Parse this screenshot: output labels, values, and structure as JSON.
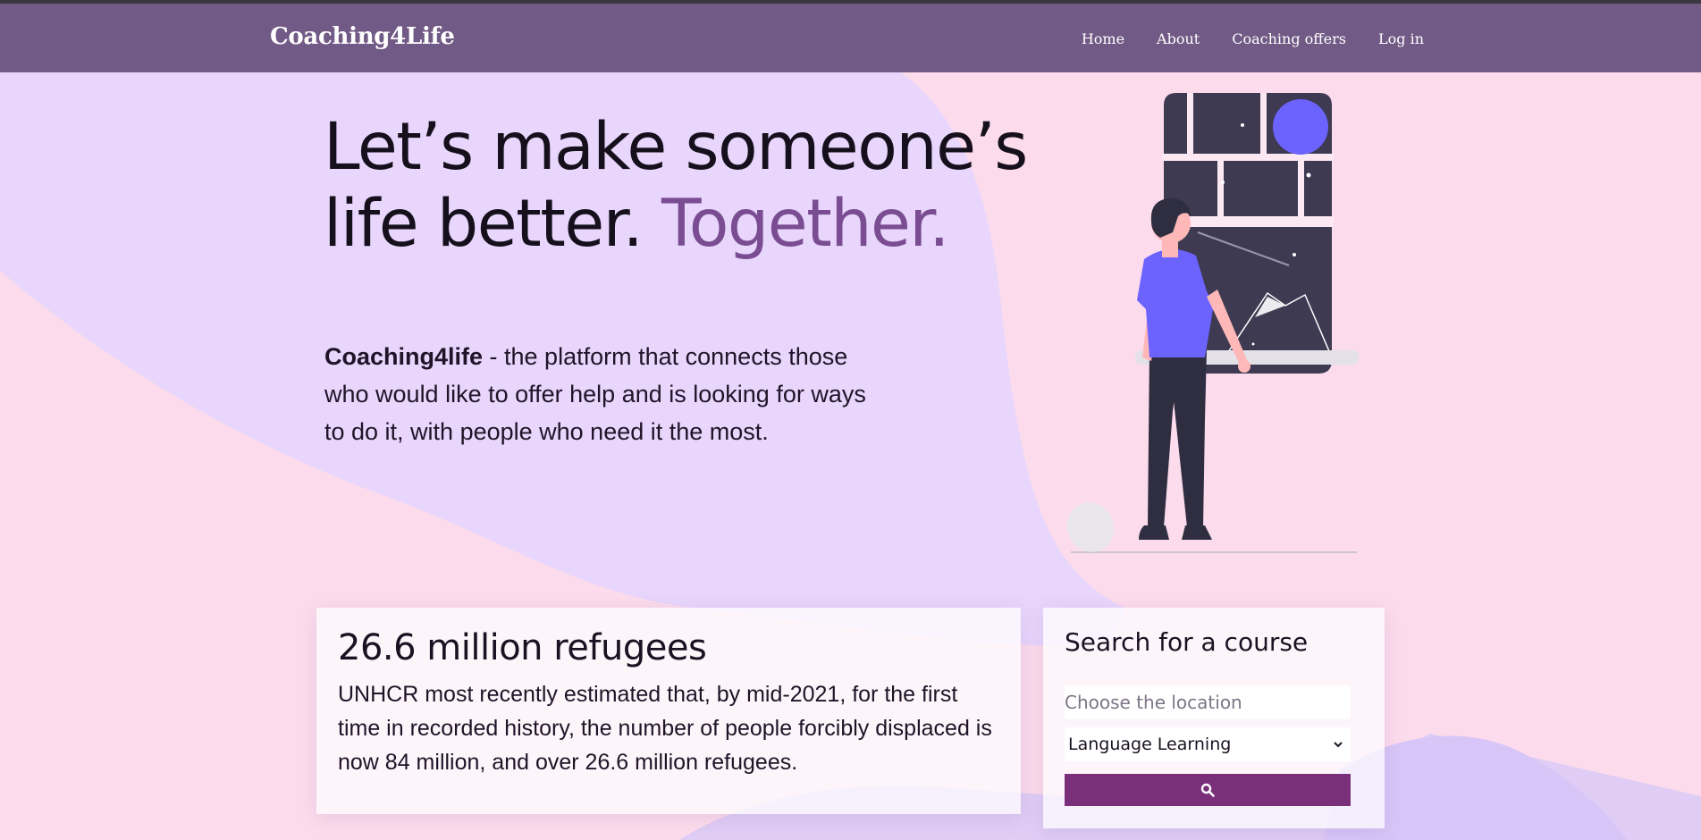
{
  "navbar": {
    "brand": "Coaching4Life",
    "links": [
      {
        "label": "Home"
      },
      {
        "label": "About"
      },
      {
        "label": "Coaching offers"
      },
      {
        "label": "Log in"
      }
    ]
  },
  "hero": {
    "title_line1": "Let’s make someone’s",
    "title_line2": "life better.",
    "title_accent": "Together.",
    "description_brand": "Coaching4life",
    "description_text": " - the platform that connects those who would like to offer help and is looking for ways to do it, with people who need it the most."
  },
  "stat_card": {
    "title": "26.6 million refugees",
    "text": "UNHCR most recently estimated that, by mid-2021, for the first time in recorded history, the number of people forcibly displaced is now 84 million, and over 26.6 million refugees."
  },
  "search_card": {
    "title": "Search for a course",
    "location_placeholder": "Choose the location",
    "location_value": "",
    "course_selected": "Language Learning",
    "search_icon": "search-icon"
  },
  "colors": {
    "navbar": "#715a85",
    "accent": "#7a4c92",
    "button": "#7a2f7b",
    "background_pink": "#fcdcec",
    "background_lavender": "#e8d6fc"
  }
}
